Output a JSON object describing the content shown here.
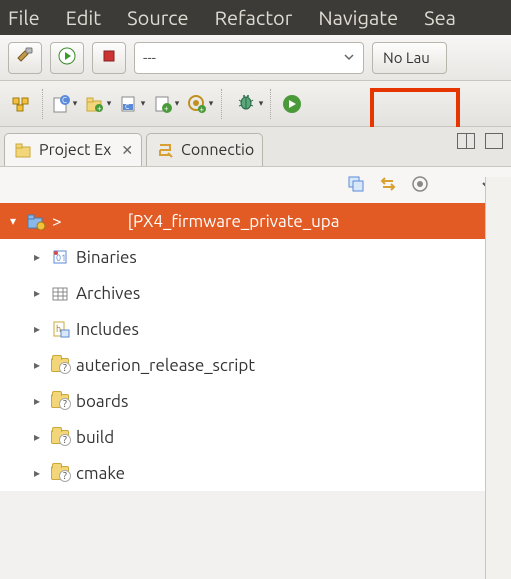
{
  "menubar": {
    "items": [
      "File",
      "Edit",
      "Source",
      "Refactor",
      "Navigate",
      "Sea"
    ]
  },
  "launch_combo": {
    "value": "---"
  },
  "launch_target": {
    "label": "No Lau"
  },
  "views": {
    "tab1": {
      "label": "Project Ex"
    },
    "tab2": {
      "label": "Connectio"
    }
  },
  "tree": {
    "root": {
      "prefix": ">",
      "detail": "[PX4_firmware_private_upa"
    },
    "children": [
      {
        "label": "Binaries",
        "icon": "binaries"
      },
      {
        "label": "Archives",
        "icon": "archives"
      },
      {
        "label": "Includes",
        "icon": "includes"
      },
      {
        "label": "auterion_release_script",
        "icon": "folder-q"
      },
      {
        "label": "boards",
        "icon": "folder-q"
      },
      {
        "label": "build",
        "icon": "folder-q"
      },
      {
        "label": "cmake",
        "icon": "folder-q"
      }
    ]
  },
  "icons": {
    "hammer": "build-icon",
    "run": "run-icon",
    "stop": "stop-icon",
    "debug": "debug-icon"
  }
}
